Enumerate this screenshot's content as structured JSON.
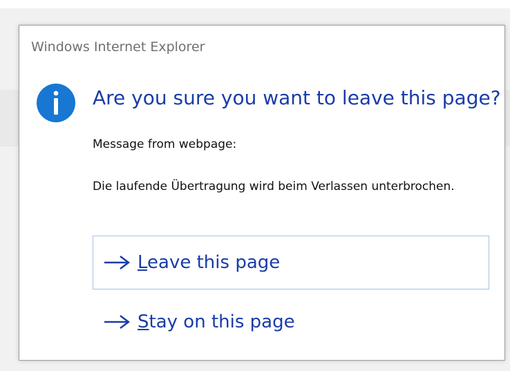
{
  "dialog": {
    "title": "Windows Internet Explorer",
    "main_instruction": "Are you sure you want to leave this page?",
    "content_label": "Message from webpage:",
    "content_message": "Die laufende Übertragung wird beim Verlassen unterbrochen.",
    "icon": "info-icon",
    "commands": [
      {
        "accel": "L",
        "rest": "eave this page",
        "icon": "arrow-right-icon",
        "focused": true
      },
      {
        "accel": "S",
        "rest": "tay on this page",
        "icon": "arrow-right-icon",
        "focused": false
      }
    ]
  },
  "colors": {
    "accent": "#1a3ca8",
    "icon_blue": "#1777d2",
    "focus_border": "#9ec3e6",
    "title_text": "#707070"
  }
}
